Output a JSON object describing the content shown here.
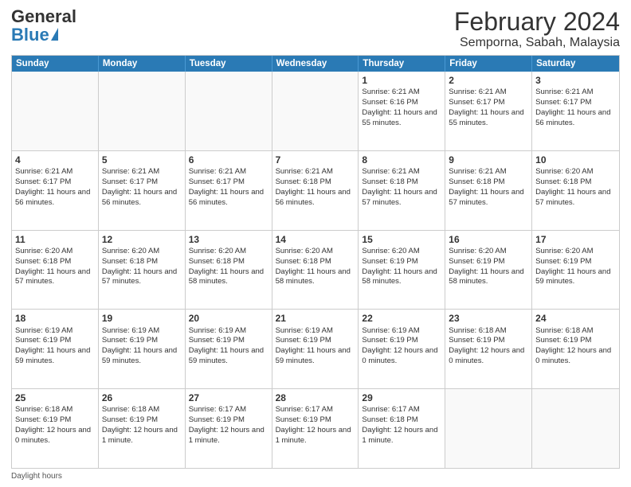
{
  "logo": {
    "general": "General",
    "blue": "Blue"
  },
  "title": "February 2024",
  "subtitle": "Semporna, Sabah, Malaysia",
  "days": [
    "Sunday",
    "Monday",
    "Tuesday",
    "Wednesday",
    "Thursday",
    "Friday",
    "Saturday"
  ],
  "footer_label": "Daylight hours",
  "weeks": [
    [
      {
        "day": "",
        "sunrise": "",
        "sunset": "",
        "daylight": ""
      },
      {
        "day": "",
        "sunrise": "",
        "sunset": "",
        "daylight": ""
      },
      {
        "day": "",
        "sunrise": "",
        "sunset": "",
        "daylight": ""
      },
      {
        "day": "",
        "sunrise": "",
        "sunset": "",
        "daylight": ""
      },
      {
        "day": "1",
        "sunrise": "Sunrise: 6:21 AM",
        "sunset": "Sunset: 6:16 PM",
        "daylight": "Daylight: 11 hours and 55 minutes."
      },
      {
        "day": "2",
        "sunrise": "Sunrise: 6:21 AM",
        "sunset": "Sunset: 6:17 PM",
        "daylight": "Daylight: 11 hours and 55 minutes."
      },
      {
        "day": "3",
        "sunrise": "Sunrise: 6:21 AM",
        "sunset": "Sunset: 6:17 PM",
        "daylight": "Daylight: 11 hours and 56 minutes."
      }
    ],
    [
      {
        "day": "4",
        "sunrise": "Sunrise: 6:21 AM",
        "sunset": "Sunset: 6:17 PM",
        "daylight": "Daylight: 11 hours and 56 minutes."
      },
      {
        "day": "5",
        "sunrise": "Sunrise: 6:21 AM",
        "sunset": "Sunset: 6:17 PM",
        "daylight": "Daylight: 11 hours and 56 minutes."
      },
      {
        "day": "6",
        "sunrise": "Sunrise: 6:21 AM",
        "sunset": "Sunset: 6:17 PM",
        "daylight": "Daylight: 11 hours and 56 minutes."
      },
      {
        "day": "7",
        "sunrise": "Sunrise: 6:21 AM",
        "sunset": "Sunset: 6:18 PM",
        "daylight": "Daylight: 11 hours and 56 minutes."
      },
      {
        "day": "8",
        "sunrise": "Sunrise: 6:21 AM",
        "sunset": "Sunset: 6:18 PM",
        "daylight": "Daylight: 11 hours and 57 minutes."
      },
      {
        "day": "9",
        "sunrise": "Sunrise: 6:21 AM",
        "sunset": "Sunset: 6:18 PM",
        "daylight": "Daylight: 11 hours and 57 minutes."
      },
      {
        "day": "10",
        "sunrise": "Sunrise: 6:20 AM",
        "sunset": "Sunset: 6:18 PM",
        "daylight": "Daylight: 11 hours and 57 minutes."
      }
    ],
    [
      {
        "day": "11",
        "sunrise": "Sunrise: 6:20 AM",
        "sunset": "Sunset: 6:18 PM",
        "daylight": "Daylight: 11 hours and 57 minutes."
      },
      {
        "day": "12",
        "sunrise": "Sunrise: 6:20 AM",
        "sunset": "Sunset: 6:18 PM",
        "daylight": "Daylight: 11 hours and 57 minutes."
      },
      {
        "day": "13",
        "sunrise": "Sunrise: 6:20 AM",
        "sunset": "Sunset: 6:18 PM",
        "daylight": "Daylight: 11 hours and 58 minutes."
      },
      {
        "day": "14",
        "sunrise": "Sunrise: 6:20 AM",
        "sunset": "Sunset: 6:18 PM",
        "daylight": "Daylight: 11 hours and 58 minutes."
      },
      {
        "day": "15",
        "sunrise": "Sunrise: 6:20 AM",
        "sunset": "Sunset: 6:19 PM",
        "daylight": "Daylight: 11 hours and 58 minutes."
      },
      {
        "day": "16",
        "sunrise": "Sunrise: 6:20 AM",
        "sunset": "Sunset: 6:19 PM",
        "daylight": "Daylight: 11 hours and 58 minutes."
      },
      {
        "day": "17",
        "sunrise": "Sunrise: 6:20 AM",
        "sunset": "Sunset: 6:19 PM",
        "daylight": "Daylight: 11 hours and 59 minutes."
      }
    ],
    [
      {
        "day": "18",
        "sunrise": "Sunrise: 6:19 AM",
        "sunset": "Sunset: 6:19 PM",
        "daylight": "Daylight: 11 hours and 59 minutes."
      },
      {
        "day": "19",
        "sunrise": "Sunrise: 6:19 AM",
        "sunset": "Sunset: 6:19 PM",
        "daylight": "Daylight: 11 hours and 59 minutes."
      },
      {
        "day": "20",
        "sunrise": "Sunrise: 6:19 AM",
        "sunset": "Sunset: 6:19 PM",
        "daylight": "Daylight: 11 hours and 59 minutes."
      },
      {
        "day": "21",
        "sunrise": "Sunrise: 6:19 AM",
        "sunset": "Sunset: 6:19 PM",
        "daylight": "Daylight: 11 hours and 59 minutes."
      },
      {
        "day": "22",
        "sunrise": "Sunrise: 6:19 AM",
        "sunset": "Sunset: 6:19 PM",
        "daylight": "Daylight: 12 hours and 0 minutes."
      },
      {
        "day": "23",
        "sunrise": "Sunrise: 6:18 AM",
        "sunset": "Sunset: 6:19 PM",
        "daylight": "Daylight: 12 hours and 0 minutes."
      },
      {
        "day": "24",
        "sunrise": "Sunrise: 6:18 AM",
        "sunset": "Sunset: 6:19 PM",
        "daylight": "Daylight: 12 hours and 0 minutes."
      }
    ],
    [
      {
        "day": "25",
        "sunrise": "Sunrise: 6:18 AM",
        "sunset": "Sunset: 6:19 PM",
        "daylight": "Daylight: 12 hours and 0 minutes."
      },
      {
        "day": "26",
        "sunrise": "Sunrise: 6:18 AM",
        "sunset": "Sunset: 6:19 PM",
        "daylight": "Daylight: 12 hours and 1 minute."
      },
      {
        "day": "27",
        "sunrise": "Sunrise: 6:17 AM",
        "sunset": "Sunset: 6:19 PM",
        "daylight": "Daylight: 12 hours and 1 minute."
      },
      {
        "day": "28",
        "sunrise": "Sunrise: 6:17 AM",
        "sunset": "Sunset: 6:19 PM",
        "daylight": "Daylight: 12 hours and 1 minute."
      },
      {
        "day": "29",
        "sunrise": "Sunrise: 6:17 AM",
        "sunset": "Sunset: 6:18 PM",
        "daylight": "Daylight: 12 hours and 1 minute."
      },
      {
        "day": "",
        "sunrise": "",
        "sunset": "",
        "daylight": ""
      },
      {
        "day": "",
        "sunrise": "",
        "sunset": "",
        "daylight": ""
      }
    ]
  ]
}
